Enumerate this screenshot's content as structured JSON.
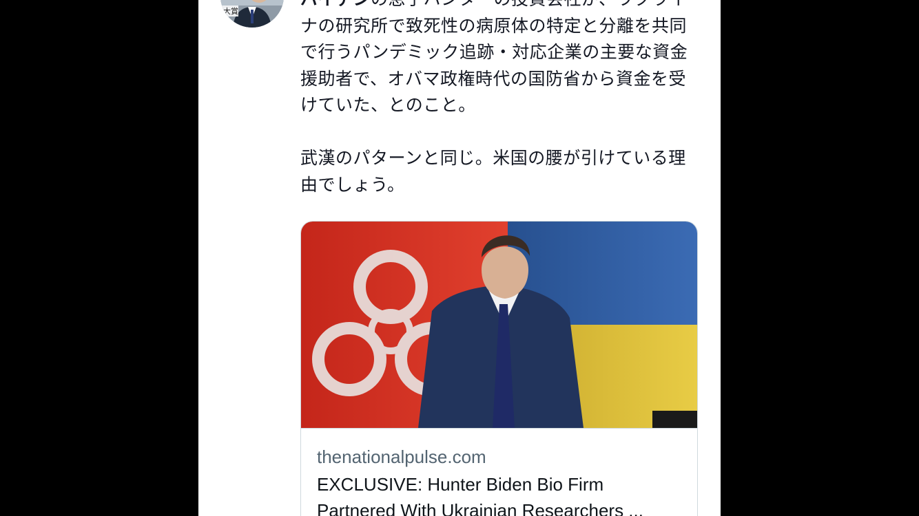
{
  "tweet": {
    "author_name": "バイデン",
    "body_line1": "の息子ハンターの投資会社が、ウクライナの研究所で致死性の病原体の特定と分離を共同で行うパンデミック追跡・対応企業の主要な資金援助者で、オバマ政権時代の国防省から資金を受けていた、とのこと。",
    "body_line2": "武漢のパターンと同じ。米国の腰が引けている理由でしょう。"
  },
  "avatar": {
    "badge_text": "大賞"
  },
  "link_card": {
    "domain": "thenationalpulse.com",
    "title": "EXCLUSIVE: Hunter Biden Bio Firm Partnered With Ukrainian Researchers ..."
  },
  "colors": {
    "text": "#141823",
    "secondary": "#536471",
    "border": "#cfd9de",
    "flag_blue": "#2f5fa8",
    "flag_yellow": "#e3c43a",
    "biohazard_red": "#d42a1c"
  }
}
